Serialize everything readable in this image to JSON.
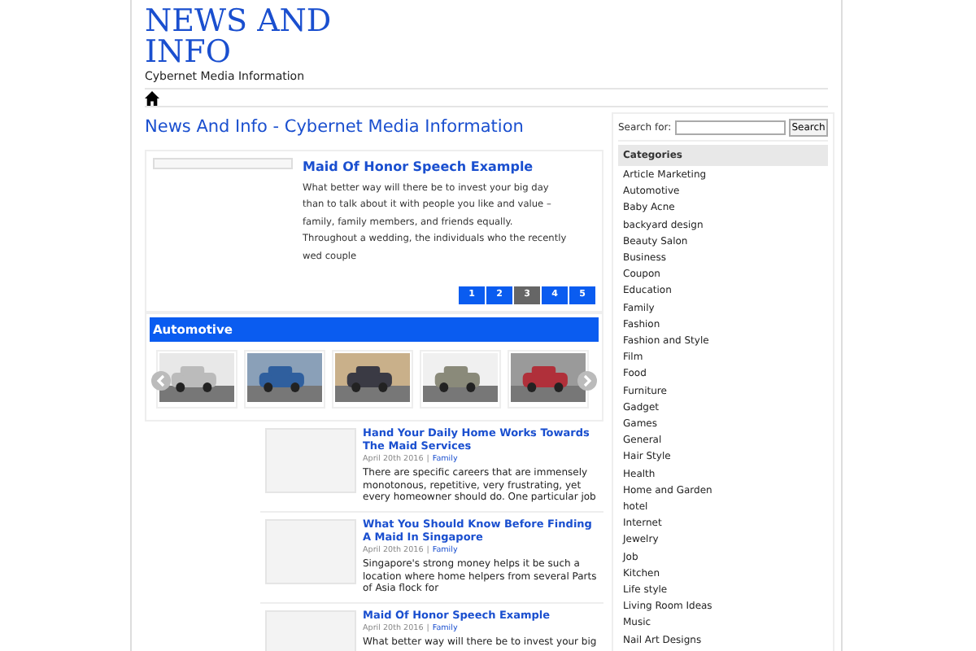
{
  "site": {
    "title": "NEWS AND INFO",
    "tagline": "Cybernet Media Information"
  },
  "page_heading": "News And Info - Cybernet Media Information",
  "featured": {
    "title": "Maid Of Honor Speech Example",
    "excerpt": "What better way will there be to invest your big day than to talk about it with people you like and value – family, family members, and friends equally. Throughout a wedding, the individuals who the recently wed couple"
  },
  "pagination": [
    {
      "label": "1",
      "selected": false
    },
    {
      "label": "2",
      "selected": false
    },
    {
      "label": "3",
      "selected": true
    },
    {
      "label": "4",
      "selected": false
    },
    {
      "label": "5",
      "selected": false
    }
  ],
  "carousel": {
    "title": "Automotive"
  },
  "posts": [
    {
      "title": "Hand Your Daily Home Works Towards The Maid Services",
      "date": "April 20th 2016",
      "separator": "|",
      "category": "Family",
      "excerpt": "There are specific careers that are immensely monotonous, repetitive, very frustrating, yet every homeowner should do. One particular job"
    },
    {
      "title": "What You Should Know Before Finding A Maid In Singapore",
      "date": "April 20th 2016",
      "separator": "|",
      "category": "Family",
      "excerpt": "Singapore's strong money helps it be such a location where home helpers from several Parts of Asia flock for"
    },
    {
      "title": "Maid Of Honor Speech Example",
      "date": "April 20th 2016",
      "separator": "|",
      "category": "Family",
      "excerpt": "What better way will there be to invest your big"
    }
  ],
  "search": {
    "label": "Search for:",
    "button": "Search"
  },
  "categories": {
    "title": "Categories",
    "items": [
      "Article Marketing",
      "Automotive",
      "Baby Acne",
      "backyard design",
      "Beauty Salon",
      "Business",
      "Coupon",
      "Education",
      "Family",
      "Fashion",
      "Fashion and Style",
      "Film",
      "Food",
      "Furniture",
      "Gadget",
      "Games",
      "General",
      "Hair Style",
      "Health",
      "Home and Garden",
      "hotel",
      "Internet",
      "Jewelry",
      "Job",
      "Kitchen",
      "Life style",
      "Living Room Ideas",
      "Music",
      "Nail Art Designs"
    ]
  }
}
